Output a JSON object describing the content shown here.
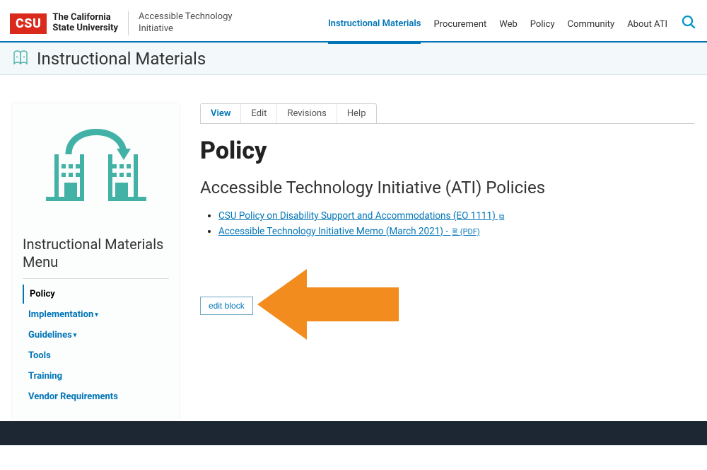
{
  "header": {
    "badge": "CSU",
    "org_line1": "The California",
    "org_line2": "State University",
    "initiative_line1": "Accessible Technology",
    "initiative_line2": "Initiative",
    "nav": [
      {
        "label": "Instructional Materials",
        "active": true
      },
      {
        "label": "Procurement",
        "active": false
      },
      {
        "label": "Web",
        "active": false
      },
      {
        "label": "Policy",
        "active": false
      },
      {
        "label": "Community",
        "active": false
      },
      {
        "label": "About ATI",
        "active": false
      }
    ]
  },
  "title_bar": {
    "title": "Instructional Materials"
  },
  "sidebar": {
    "menu_title": "Instructional Materials Menu",
    "items": [
      {
        "label": "Policy",
        "active": true,
        "caret": false
      },
      {
        "label": "Implementation",
        "active": false,
        "caret": true
      },
      {
        "label": "Guidelines",
        "active": false,
        "caret": true
      },
      {
        "label": "Tools",
        "active": false,
        "caret": false
      },
      {
        "label": "Training",
        "active": false,
        "caret": false
      },
      {
        "label": "Vendor Requirements",
        "active": false,
        "caret": false
      }
    ]
  },
  "content": {
    "tabs": [
      {
        "label": "View",
        "active": true
      },
      {
        "label": "Edit",
        "active": false
      },
      {
        "label": "Revisions",
        "active": false
      },
      {
        "label": "Help",
        "active": false
      }
    ],
    "page_heading": "Policy",
    "section_heading": "Accessible Technology Initiative (ATI) Policies",
    "policies": [
      {
        "text": "CSU Policy on Disability Support and Accommodations (EO 1111)",
        "type": "external"
      },
      {
        "text": "Accessible Technology Initiative Memo (March 2021) - ",
        "type": "pdf",
        "pdf_tag": "(PDF)"
      }
    ],
    "edit_block_label": "edit block"
  }
}
